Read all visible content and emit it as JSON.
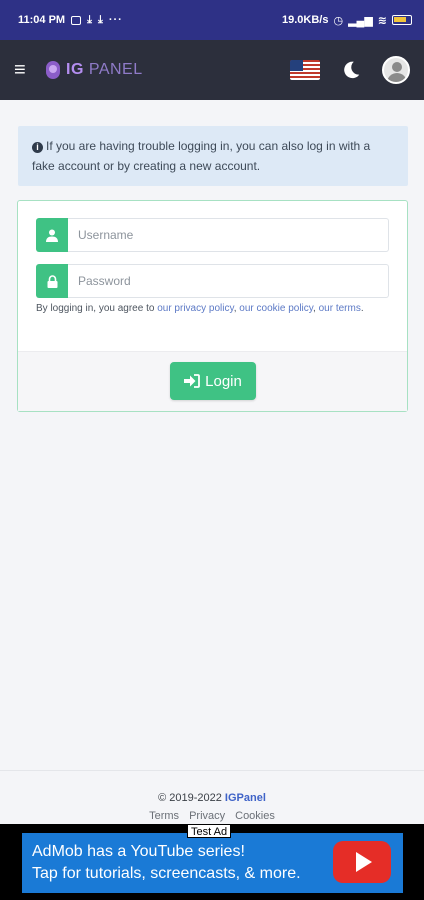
{
  "status_bar": {
    "time": "11:04 PM",
    "speed": "19.0KB/s",
    "notification_icons": [
      "message-icon",
      "download-icon",
      "download-icon"
    ],
    "more": "···",
    "battery_color": "#f3c53c"
  },
  "app_bar": {
    "brand_ig": "IG",
    "brand_panel": "PANEL",
    "menu_icon": "hamburger-icon",
    "language_icon": "us-flag-icon",
    "theme_icon": "moon-icon",
    "profile_icon": "avatar-icon"
  },
  "alert": {
    "icon": "info-icon",
    "text": "If you are having trouble logging in, you can also log in with a fake account or by creating a new account."
  },
  "login_form": {
    "username_placeholder": "Username",
    "password_placeholder": "Password",
    "agree_prefix": "By logging in, you agree to ",
    "privacy_link": "our privacy policy",
    "cookie_link": "our cookie policy",
    "terms_link": "our terms",
    "login_label": "Login",
    "accent_color": "#3fc284"
  },
  "footer": {
    "copyright": "© 2019-2022 ",
    "brand": "IGPanel",
    "links": [
      "Terms",
      "Privacy",
      "Cookies"
    ]
  },
  "ad": {
    "tag": "Test Ad",
    "line1": "AdMob has a YouTube series!",
    "line2": "Tap for tutorials, screencasts, & more.",
    "icon": "youtube-icon"
  }
}
